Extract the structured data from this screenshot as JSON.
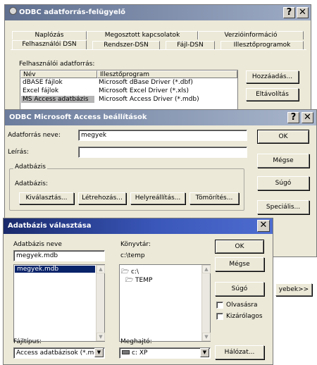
{
  "win1": {
    "title": "ODBC adatforrás-felügyelő",
    "help_btn": "?",
    "close_btn": "✕",
    "tabs_row1": [
      "Naplózás",
      "Megosztott kapcsolatok",
      "Verzióinformáció"
    ],
    "tabs_row2": [
      "Felhasználói DSN",
      "Rendszer-DSN",
      "Fájl-DSN",
      "Illesztőprogramok"
    ],
    "list_label": "Felhasználói adatforrás:",
    "col_name": "Név",
    "col_driver": "Illesztőprogram",
    "rows": [
      {
        "name": "dBASE fájlok",
        "driver": "Microsoft dBase Driver (*.dbf)"
      },
      {
        "name": "Excel fájlok",
        "driver": "Microsoft Excel Driver (*.xls)"
      },
      {
        "name": "MS Access adatbázis",
        "driver": "Microsoft Access Driver (*.mdb)"
      }
    ],
    "add_button": "Hozzáadás...",
    "remove_button": "Eltávolítás"
  },
  "win2": {
    "title": "ODBC Microsoft Access beállítások",
    "help_btn": "?",
    "close_btn": "✕",
    "dsn_label": "Adatforrás neve:",
    "dsn_value": "megyek",
    "desc_label": "Leírás:",
    "desc_value": "",
    "db_group": "Adatbázis",
    "db_label": "Adatbázis:",
    "select_button": "Kiválasztás...",
    "create_button": "Létrehozás...",
    "repair_button": "Helyreállítás...",
    "compact_button": "Tömörítés...",
    "ok_button": "OK",
    "cancel_button": "Mégse",
    "help_button": "Súgó",
    "advanced_button": "Speciális...",
    "options_button_fragment": "yebek>>"
  },
  "win3": {
    "title": "Adatbázis választása",
    "close_btn": "✕",
    "dbname_label": "Adatbázis neve",
    "dbname_value": "megyek.mdb",
    "files": [
      "megyek.mdb"
    ],
    "dir_label": "Könyvtár:",
    "dir_value": "c:\\temp",
    "dirs": [
      "c:\\",
      "TEMP"
    ],
    "filetype_label": "Fájltípus:",
    "filetype_value": "Access adatbázisok (*.mc",
    "drive_label": "Meghajtó:",
    "drive_value": "c: XP",
    "ok_button": "OK",
    "cancel_button": "Mégse",
    "help_button": "Súgó",
    "readonly_label": "Olvasásra",
    "exclusive_label": "Kizárólagos",
    "network_button": "Hálózat..."
  }
}
